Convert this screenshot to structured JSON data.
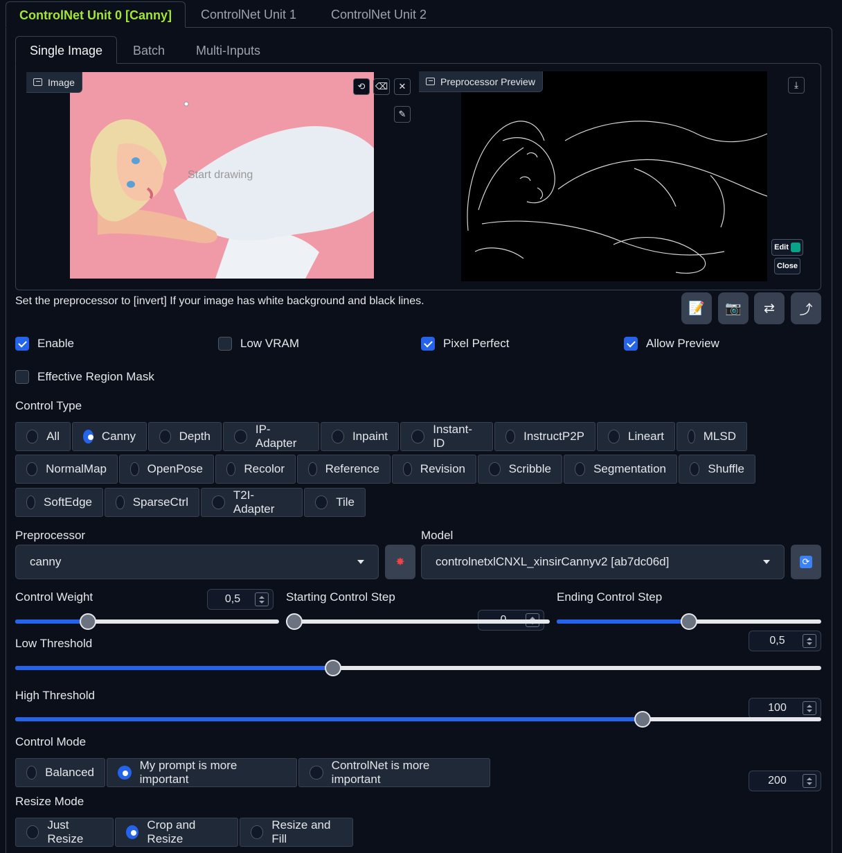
{
  "unit_tabs": [
    "ControlNet Unit 0 [Canny]",
    "ControlNet Unit 1",
    "ControlNet Unit 2"
  ],
  "image_tabs": [
    "Single Image",
    "Batch",
    "Multi-Inputs"
  ],
  "image_panel": {
    "label": "Image",
    "placeholder": "Start drawing"
  },
  "preview_panel": {
    "label": "Preprocessor Preview",
    "edit_label": "Edit",
    "close_label": "Close"
  },
  "hint": "Set the preprocessor to [invert] If your image has white background and black lines.",
  "checkboxes": [
    {
      "label": "Enable",
      "checked": true
    },
    {
      "label": "Low VRAM",
      "checked": false
    },
    {
      "label": "Pixel Perfect",
      "checked": true
    },
    {
      "label": "Allow Preview",
      "checked": true
    },
    {
      "label": "Effective Region Mask",
      "checked": false
    }
  ],
  "control_type": {
    "label": "Control Type",
    "options": [
      "All",
      "Canny",
      "Depth",
      "IP-Adapter",
      "Inpaint",
      "Instant-ID",
      "InstructP2P",
      "Lineart",
      "MLSD",
      "NormalMap",
      "OpenPose",
      "Recolor",
      "Reference",
      "Revision",
      "Scribble",
      "Segmentation",
      "Shuffle",
      "SoftEdge",
      "SparseCtrl",
      "T2I-Adapter",
      "Tile"
    ],
    "selected": "Canny"
  },
  "preprocessor": {
    "label": "Preprocessor",
    "value": "canny"
  },
  "model": {
    "label": "Model",
    "value": "controlnetxlCNXL_xinsirCannyv2 [ab7dc06d]"
  },
  "sliders": {
    "control_weight": {
      "label": "Control Weight",
      "value": "0,5",
      "fraction": 0.26
    },
    "starting_step": {
      "label": "Starting Control Step",
      "value": "0",
      "fraction": 0.0
    },
    "ending_step": {
      "label": "Ending Control Step",
      "value": "0,5",
      "fraction": 0.5
    },
    "low_threshold": {
      "label": "Low Threshold",
      "value": "100",
      "fraction": 0.392
    },
    "high_threshold": {
      "label": "High Threshold",
      "value": "200",
      "fraction": 0.784
    }
  },
  "control_mode": {
    "label": "Control Mode",
    "options": [
      "Balanced",
      "My prompt is more important",
      "ControlNet is more important"
    ],
    "selected": "My prompt is more important"
  },
  "resize_mode": {
    "label": "Resize Mode",
    "options": [
      "Just Resize",
      "Crop and Resize",
      "Resize and Fill"
    ],
    "selected": "Crop and Resize"
  },
  "colors": {
    "accent": "#2563eb",
    "active_tab": "#a3e635",
    "background": "#0b0f19",
    "image_bg": "#f09aa8"
  }
}
